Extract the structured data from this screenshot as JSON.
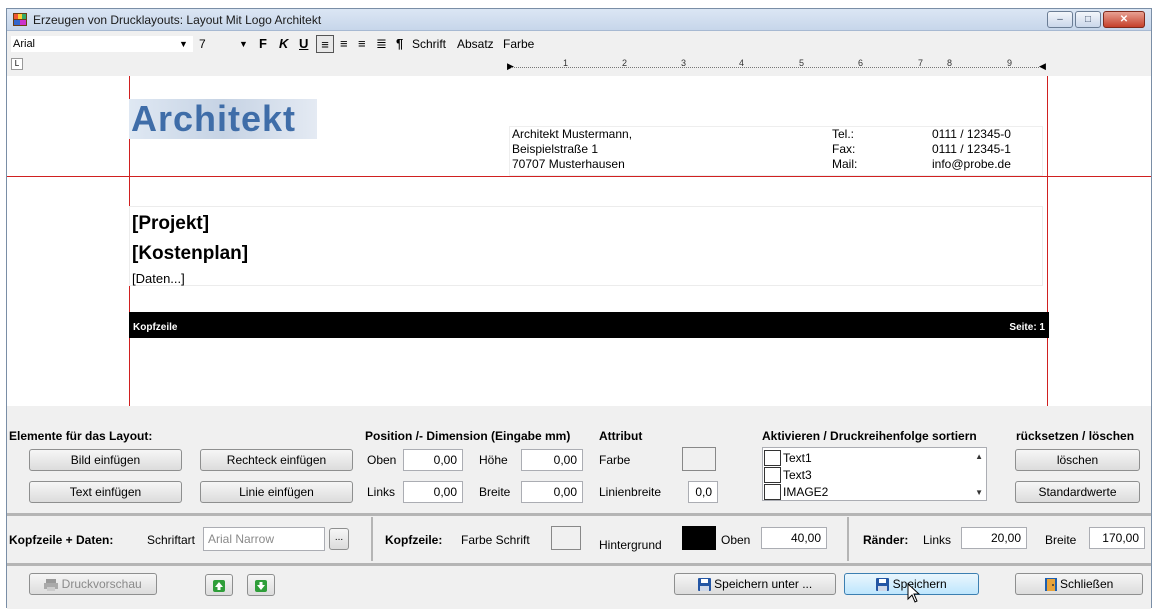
{
  "window": {
    "title": "Erzeugen von Drucklayouts: Layout Mit Logo Architekt",
    "minimize": "–",
    "maximize": "□",
    "close": "✕"
  },
  "toolbar": {
    "font": "Arial",
    "size": "7",
    "bold": "F",
    "italic": "K",
    "underline": "U",
    "align_left": "≡",
    "align_center": "≡",
    "align_right": "≡",
    "align_justify": "≣",
    "paragraph_mark": "¶",
    "menu_schrift": "Schrift",
    "menu_absatz": "Absatz",
    "menu_farbe": "Farbe"
  },
  "ruler": {
    "ticks": [
      "1",
      "2",
      "3",
      "4",
      "5",
      "6",
      "7",
      "8",
      "9"
    ]
  },
  "preview": {
    "logo_text": "Architekt",
    "address": [
      "Architekt Mustermann,",
      "Beispielstraße 1",
      "70707 Musterhausen"
    ],
    "contact_labels": [
      "Tel.:",
      "Fax:",
      "Mail:"
    ],
    "contact_values": [
      "0111 / 12345-0",
      "0111 / 12345-1",
      "info@probe.de"
    ],
    "projekt": "[Projekt]",
    "kostenplan": "[Kostenplan]",
    "daten": "[Daten...]",
    "header_left": "Kopfzeile",
    "header_right": "Seite: 1"
  },
  "elements": {
    "title": "Elemente für das Layout:",
    "bild": "Bild einfügen",
    "rechteck": "Rechteck einfügen",
    "text": "Text einfügen",
    "linie": "Linie einfügen"
  },
  "position": {
    "title": "Position /- Dimension (Eingabe mm)",
    "oben_label": "Oben",
    "oben": "0,00",
    "hoehe_label": "Höhe",
    "hoehe": "0,00",
    "links_label": "Links",
    "links": "0,00",
    "breite_label": "Breite",
    "breite": "0,00"
  },
  "attribut": {
    "title": "Attribut",
    "farbe_label": "Farbe",
    "linienbreite_label": "Linienbreite",
    "linienbreite": "0,0"
  },
  "activate": {
    "title": "Aktivieren / Druckreihenfolge sortiern",
    "items": [
      "Text1",
      "Text3",
      "IMAGE2"
    ]
  },
  "reset": {
    "title": "rücksetzen / löschen",
    "loeschen": "löschen",
    "standard": "Standardwerte"
  },
  "kopfzeile_daten": {
    "label": "Kopfzeile + Daten:",
    "schriftart_label": "Schriftart",
    "schriftart": "Arial Narrow",
    "browse": "..."
  },
  "kopfzeile": {
    "label": "Kopfzeile:",
    "farbe_schrift_label": "Farbe Schrift",
    "hintergrund_label": "Hintergrund",
    "oben_label": "Oben",
    "oben": "40,00",
    "colors": {
      "schrift": "#ffffff",
      "hintergrund": "#000000"
    }
  },
  "raender": {
    "label": "Ränder:",
    "links_label": "Links",
    "links": "20,00",
    "breite_label": "Breite",
    "breite": "170,00"
  },
  "footer": {
    "druckvorschau": "Druckvorschau",
    "speichern_unter": "Speichern unter ...",
    "speichern": "Speichern",
    "schliessen": "Schließen"
  }
}
